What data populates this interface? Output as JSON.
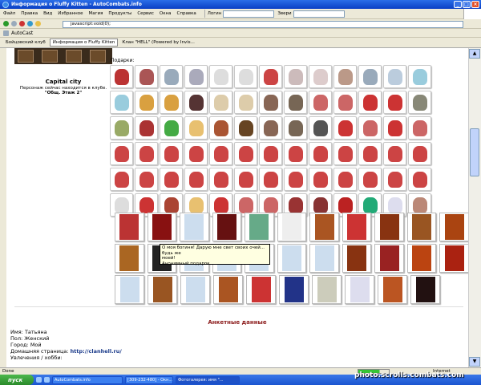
{
  "window": {
    "title": "Информация о Fluffy Kitten - AutoCombats.info"
  },
  "menu": [
    "Файл",
    "Правка",
    "Вид",
    "Избранное",
    "Магия",
    "Продукты",
    "Сервис",
    "Окна",
    "Справка"
  ],
  "toolbar": {
    "login_label": "Логин",
    "bots_label": "Звери"
  },
  "address": {
    "value": "javascript:void(0);"
  },
  "links": {
    "item": "AutoCast"
  },
  "tabs": [
    "Бойцовский клуб",
    "Информация о Fluffy Kitten",
    "Клан \"HELL\" (Powered by Invis..."
  ],
  "profile": {
    "city": "Capital city",
    "location_line1": "Персонаж сейчас находится в клубе.",
    "location_line2": "\"Общ. Этаж 2\""
  },
  "gifts": {
    "label": "Подарки:"
  },
  "tooltip": {
    "line1": "О моя богиня! Дарую мне свет своих очей... будь же",
    "line2": "моей!",
    "line3": "Анонимный подарок"
  },
  "anketa": {
    "title": "Анкетные данные",
    "name_label": "Имя:",
    "name": "Татьяна",
    "sex_label": "Пол:",
    "sex": "Женский",
    "city_label": "Город:",
    "city": "Мой",
    "home_label": "Домашняя страница:",
    "home": "http://clanhell.ru/",
    "hobby_label": "Увлечения / хобби:"
  },
  "status": {
    "text": "Done",
    "zone": "Internet"
  },
  "taskbar": {
    "start": "пуск",
    "tasks": [
      "AutoCombats.info",
      "[309-232-480] - Окн...",
      "Фотогалерея: имя \"..."
    ]
  },
  "watermark": "photo.scrolls.combats.com",
  "colors": {
    "title_bar": "#0a3fc4",
    "anketa_title": "#8b1a1a",
    "hyperlink": "#1a3a8a"
  }
}
